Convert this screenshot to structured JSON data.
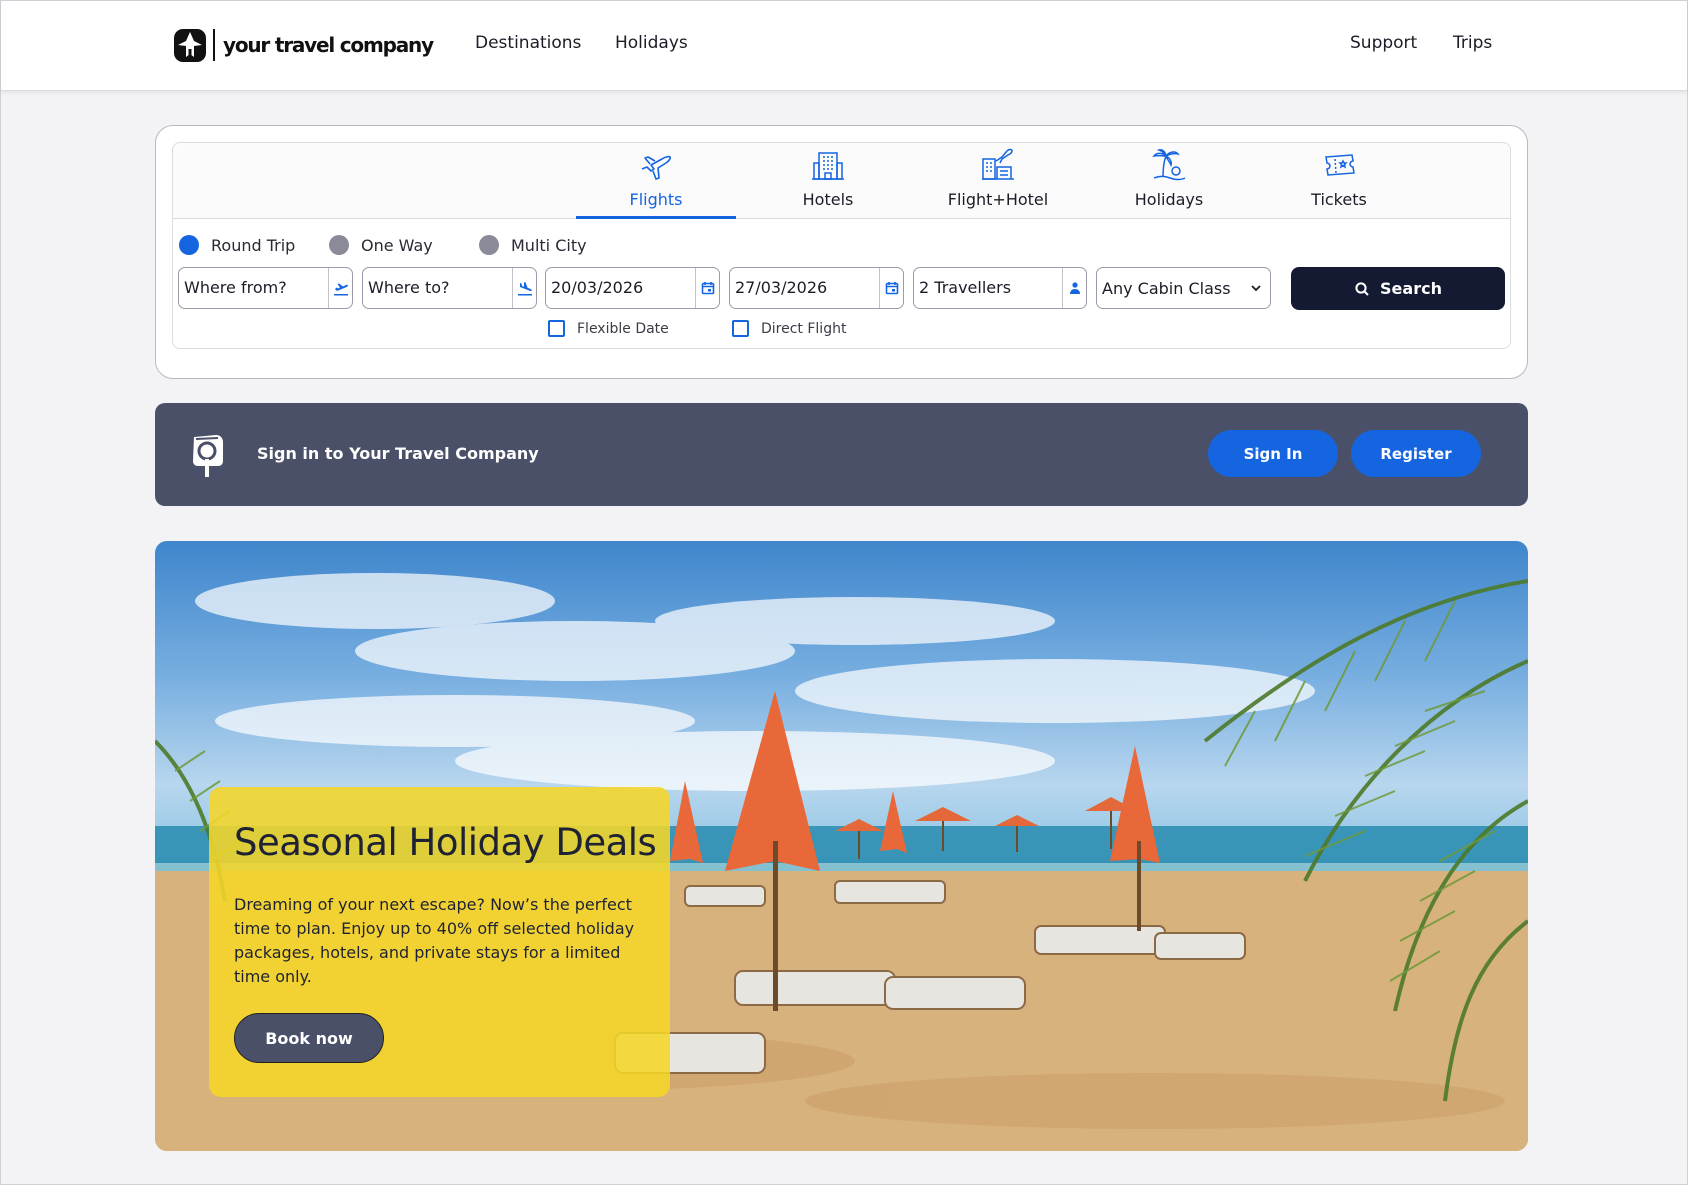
{
  "header": {
    "logo_text": "your travel company",
    "nav_left": [
      "Destinations",
      "Holidays"
    ],
    "nav_right": [
      "Support",
      "Trips"
    ]
  },
  "search": {
    "tabs": [
      {
        "label": "Flights",
        "icon": "plane-icon",
        "active": true
      },
      {
        "label": "Hotels",
        "icon": "hotel-building-icon",
        "active": false
      },
      {
        "label": "Flight+Hotel",
        "icon": "flight-hotel-icon",
        "active": false
      },
      {
        "label": "Holidays",
        "icon": "palm-tree-icon",
        "active": false
      },
      {
        "label": "Tickets",
        "icon": "ticket-icon",
        "active": false
      }
    ],
    "trip_types": [
      {
        "label": "Round Trip",
        "checked": true
      },
      {
        "label": "One Way",
        "checked": false
      },
      {
        "label": "Multi City",
        "checked": false
      }
    ],
    "from_placeholder": "Where from?",
    "to_placeholder": "Where to?",
    "depart_date": "20/03/2026",
    "return_date": "27/03/2026",
    "travellers": "2 Travellers",
    "cabin_class": "Any Cabin Class",
    "search_label": "Search",
    "flexible_date_label": "Flexible Date",
    "direct_flight_label": "Direct Flight"
  },
  "signin": {
    "text": "Sign in to Your Travel Company",
    "signin_label": "Sign In",
    "register_label": "Register"
  },
  "hero": {
    "title": "Seasonal Holiday Deals",
    "body": "Dreaming of your next escape? Now’s the perfect time to plan. Enjoy up to 40% off selected holiday packages, hotels, and private stays for a limited time only.",
    "cta_label": "Book now"
  },
  "colors": {
    "accent": "#1565e0",
    "dark_button": "#151a33",
    "banner": "#4a5068",
    "promo_yellow": "#f5d628"
  }
}
